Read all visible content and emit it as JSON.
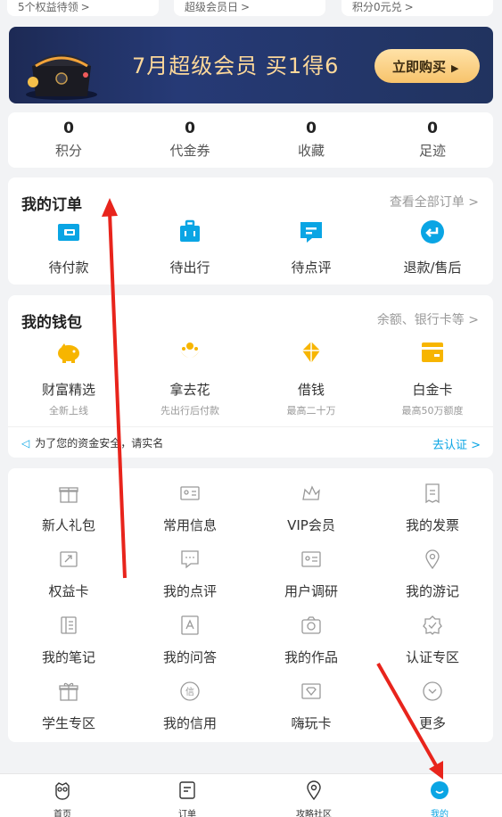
{
  "top_cards": [
    {
      "label": "5个权益待领",
      "chev": ">"
    },
    {
      "label": "超级会员日",
      "chev": ">"
    },
    {
      "label": "积分0元兑",
      "chev": ">"
    }
  ],
  "banner": {
    "title": "7月超级会员 买1得6",
    "button": "立即购买",
    "button_icon": "▶"
  },
  "stats": [
    {
      "value": "0",
      "label": "积分"
    },
    {
      "value": "0",
      "label": "代金券"
    },
    {
      "value": "0",
      "label": "收藏"
    },
    {
      "value": "0",
      "label": "足迹"
    }
  ],
  "orders": {
    "title": "我的订单",
    "link": "查看全部订单 >",
    "items": [
      {
        "label": "待付款",
        "icon": "wallet-card-icon"
      },
      {
        "label": "待出行",
        "icon": "luggage-icon"
      },
      {
        "label": "待点评",
        "icon": "comment-icon"
      },
      {
        "label": "退款/售后",
        "icon": "refund-icon"
      }
    ]
  },
  "wallet": {
    "title": "我的钱包",
    "link": "余额、银行卡等 >",
    "items": [
      {
        "label": "财富精选",
        "sub": "全新上线",
        "icon": "piggy-bank-icon"
      },
      {
        "label": "拿去花",
        "sub": "先出行后付款",
        "icon": "flower-icon"
      },
      {
        "label": "借钱",
        "sub": "最高二十万",
        "icon": "money-bag-icon"
      },
      {
        "label": "白金卡",
        "sub": "最高50万额度",
        "icon": "card-icon"
      }
    ],
    "notice": "为了您的资金安全，请实名",
    "verify": "去认证 >"
  },
  "tools": [
    {
      "label": "新人礼包",
      "icon": "gift-box-icon"
    },
    {
      "label": "常用信息",
      "icon": "id-card-icon"
    },
    {
      "label": "VIP会员",
      "icon": "crown-icon"
    },
    {
      "label": "我的发票",
      "icon": "invoice-icon"
    },
    {
      "label": "权益卡",
      "icon": "ticket-icon"
    },
    {
      "label": "我的点评",
      "icon": "chat-bubble-icon"
    },
    {
      "label": "用户调研",
      "icon": "survey-icon"
    },
    {
      "label": "我的游记",
      "icon": "location-pin-icon"
    },
    {
      "label": "我的笔记",
      "icon": "notebook-icon"
    },
    {
      "label": "我的问答",
      "icon": "qa-icon"
    },
    {
      "label": "我的作品",
      "icon": "camera-icon"
    },
    {
      "label": "认证专区",
      "icon": "badge-icon"
    },
    {
      "label": "学生专区",
      "icon": "present-icon"
    },
    {
      "label": "我的信用",
      "icon": "credit-icon"
    },
    {
      "label": "嗨玩卡",
      "icon": "play-card-icon"
    },
    {
      "label": "更多",
      "icon": "more-icon"
    }
  ],
  "tabs": [
    {
      "label": "首页",
      "icon": "home-owl-icon"
    },
    {
      "label": "订单",
      "icon": "order-icon"
    },
    {
      "label": "攻略社区",
      "icon": "community-pin-icon"
    },
    {
      "label": "我的",
      "icon": "profile-smile-icon",
      "active": true
    }
  ],
  "colors": {
    "accent": "#0aa5e4",
    "wallet_yellow": "#f7b500",
    "order_blue": "#0aa5e4",
    "annotation_red": "#e8241c",
    "banner_gold": "#fdd89a"
  }
}
